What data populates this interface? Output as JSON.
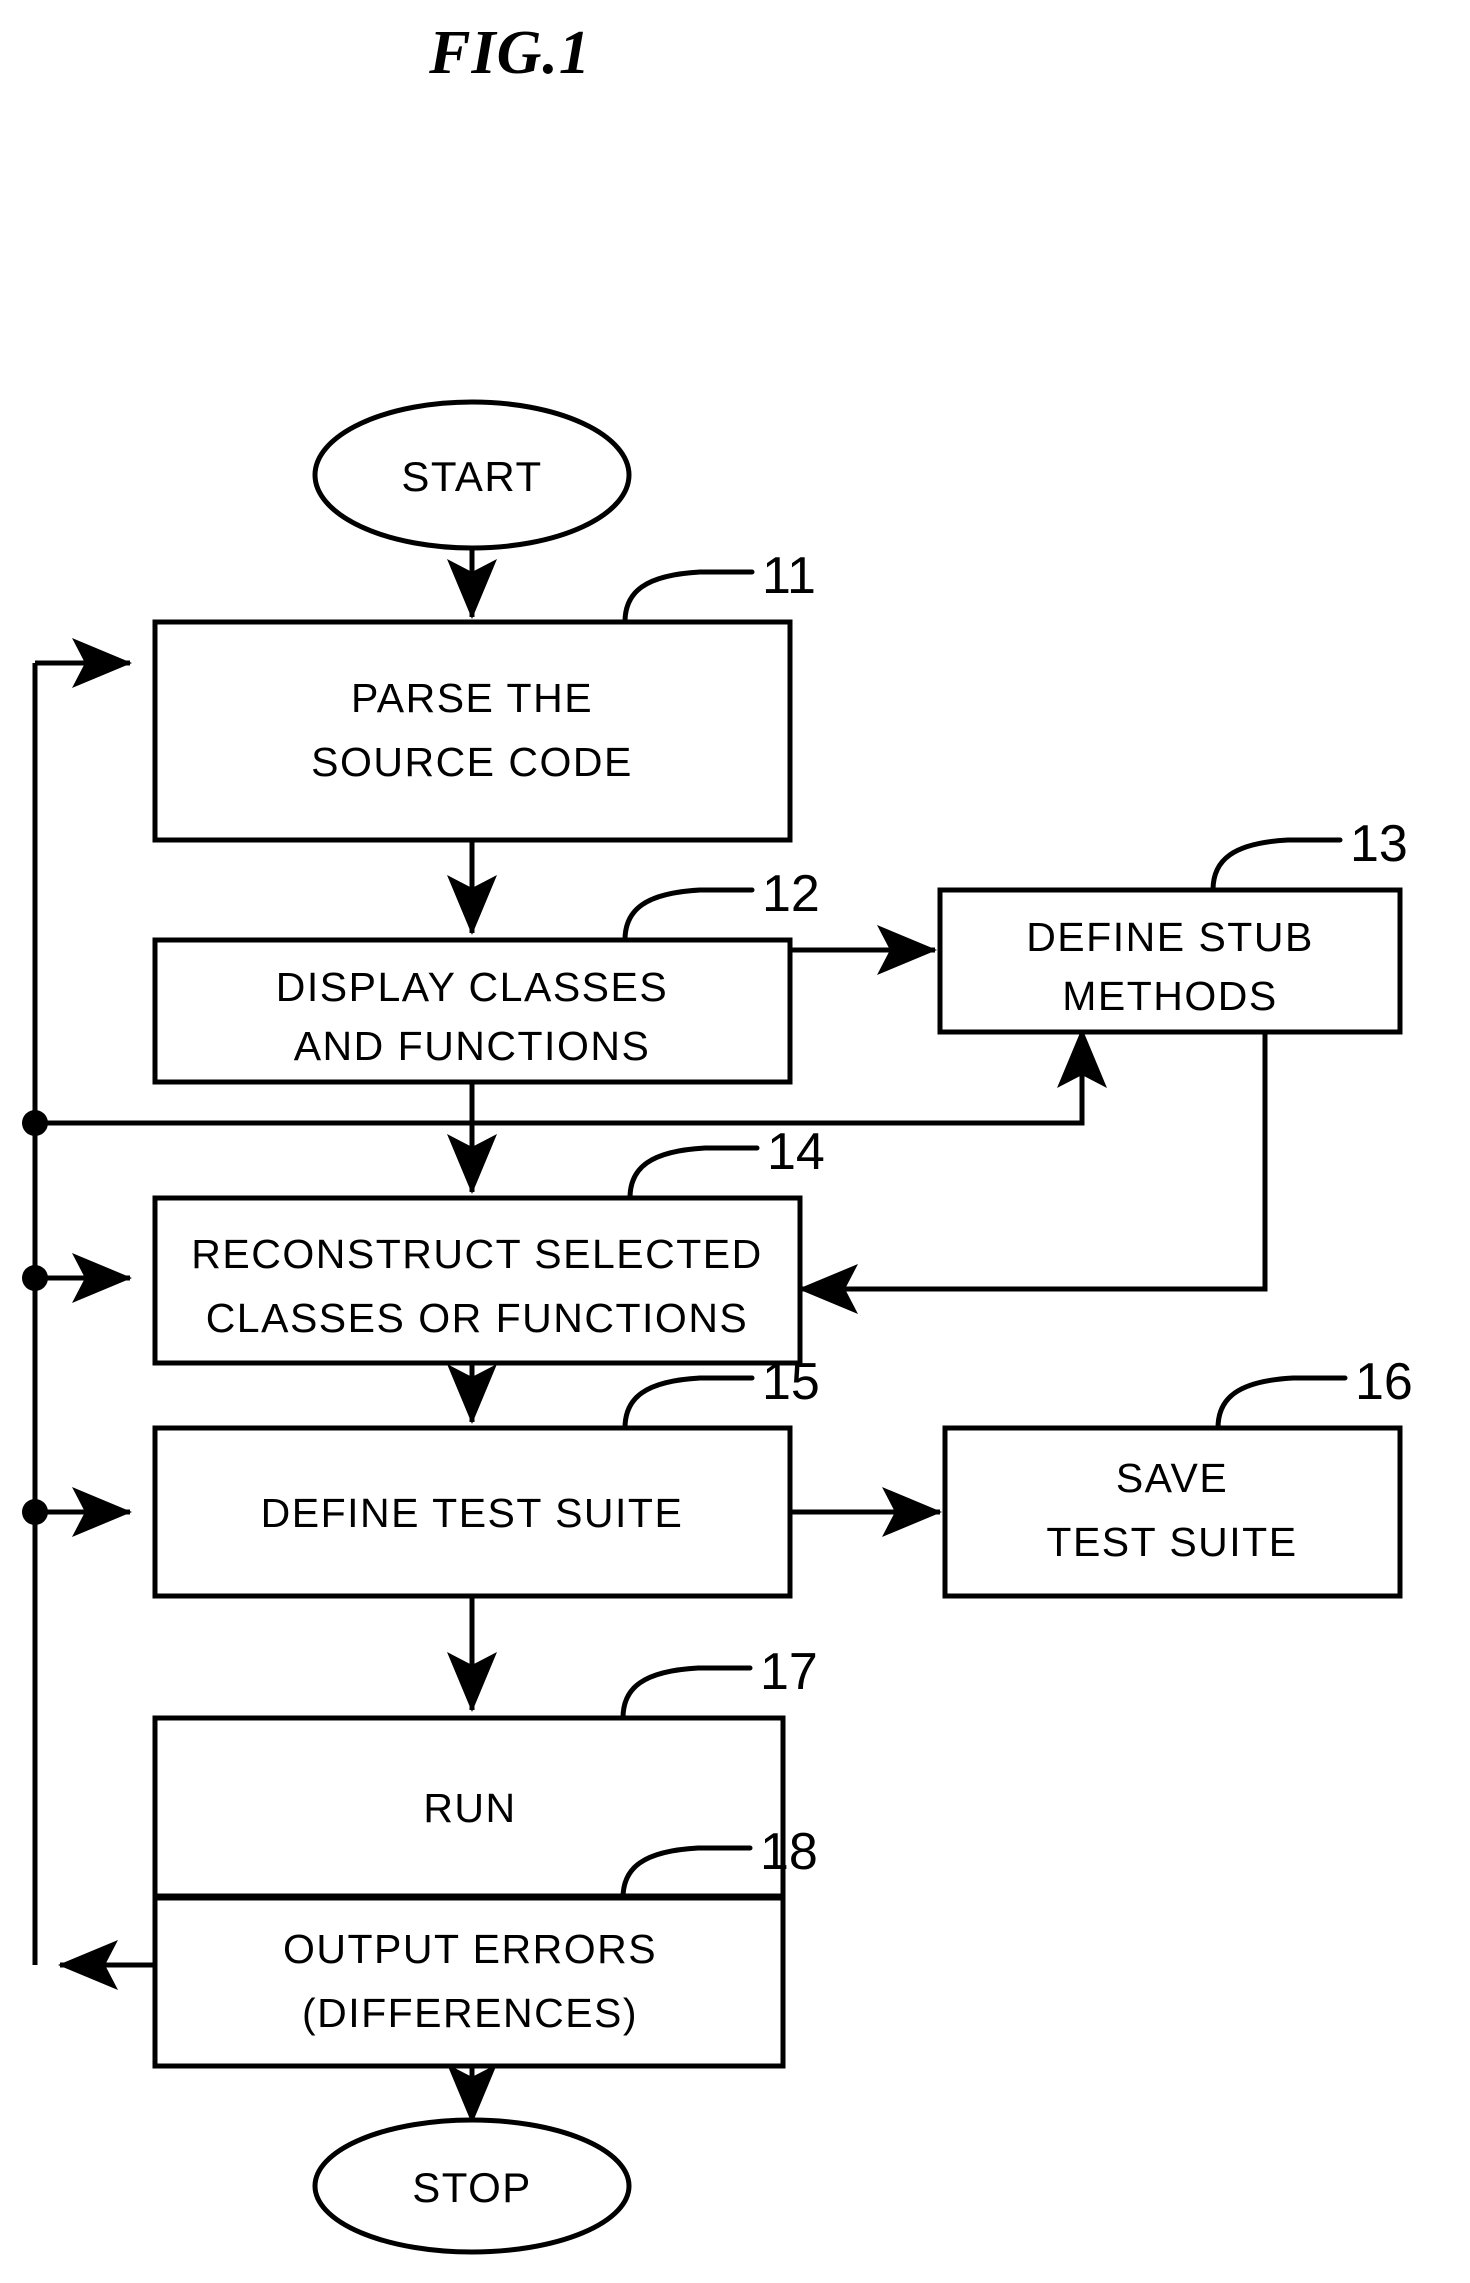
{
  "figure": {
    "title": "FIG.1",
    "type": "flowchart"
  },
  "terminators": [
    {
      "id": "start",
      "label": "START"
    },
    {
      "id": "stop",
      "label": "STOP"
    }
  ],
  "steps": [
    {
      "ref": "11",
      "lines": [
        "PARSE  THE",
        "SOURCE  CODE"
      ]
    },
    {
      "ref": "12",
      "lines": [
        "DISPLAY  CLASSES",
        "AND  FUNCTIONS"
      ]
    },
    {
      "ref": "13",
      "lines": [
        "DEFINE  STUB",
        "METHODS"
      ]
    },
    {
      "ref": "14",
      "lines": [
        "RECONSTRUCT SELECTED",
        "CLASSES  OR  FUNCTIONS"
      ]
    },
    {
      "ref": "15",
      "lines": [
        "DEFINE  TEST  SUITE"
      ]
    },
    {
      "ref": "16",
      "lines": [
        "SAVE",
        "TEST  SUITE"
      ]
    },
    {
      "ref": "17",
      "lines": [
        "RUN"
      ]
    },
    {
      "ref": "18",
      "lines": [
        "OUTPUT  ERRORS",
        "(DIFFERENCES)"
      ]
    }
  ],
  "colors": {
    "ink": "#000000",
    "paper": "#ffffff"
  }
}
